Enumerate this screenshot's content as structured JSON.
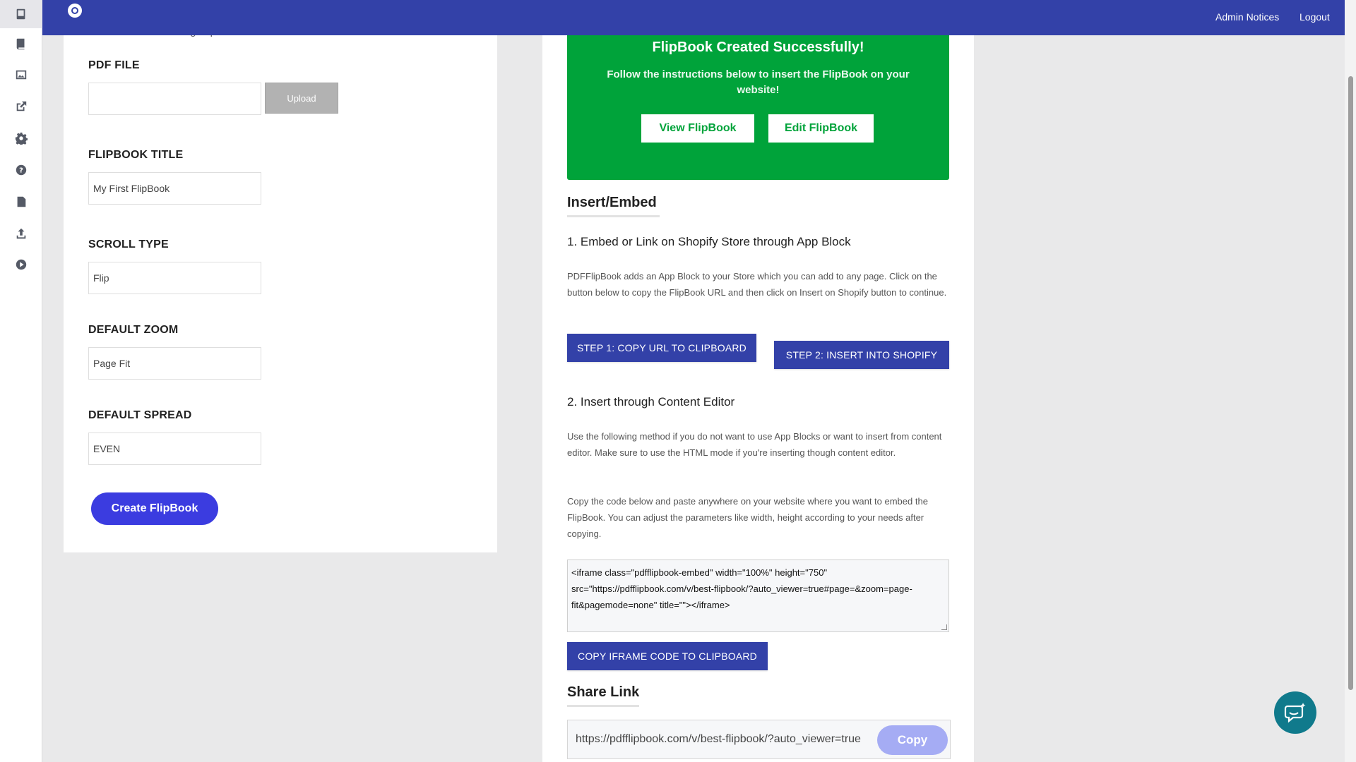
{
  "sidebar": {
    "icons": [
      "flipbooks-icon",
      "book-icon",
      "image-icon",
      "external-link-icon",
      "gear-icon",
      "help-icon",
      "document-icon",
      "upload-icon",
      "play-icon"
    ]
  },
  "topbar": {
    "admin_notices": "Admin Notices",
    "logout": "Logout"
  },
  "form": {
    "cut_text": "and create an amazing FlipBook with that.",
    "pdf_file_label": "PDF FILE",
    "pdf_file_value": "",
    "upload_label": "Upload",
    "title_label": "FLIPBOOK TITLE",
    "title_value": "My First FlipBook",
    "scroll_label": "SCROLL TYPE",
    "scroll_value": "Flip",
    "zoom_label": "DEFAULT ZOOM",
    "zoom_value": "Page Fit",
    "spread_label": "DEFAULT SPREAD",
    "spread_value": "EVEN",
    "create_label": "Create FlipBook"
  },
  "success": {
    "title": "FlipBook Created Successfully!",
    "subtitle": "Follow the instructions below to insert the FlipBook on your website!",
    "view_label": "View FlipBook",
    "edit_label": "Edit FlipBook"
  },
  "embed": {
    "heading": "Insert/Embed",
    "section1_title": "1. Embed or Link on Shopify Store through App Block",
    "section1_text": "PDFFlipBook adds an App Block to your Store which you can add to any page. Click on the button below to copy the FlipBook URL and then click on Insert on Shopify button to continue.",
    "step1_label": "STEP 1: COPY URL TO CLIPBOARD",
    "step2_label": "STEP 2: INSERT INTO SHOPIFY",
    "section2_title": "2. Insert through Content Editor",
    "section2_text1": "Use the following method if you do not want to use App Blocks or want to insert from content editor. Make sure to use the HTML mode if you're inserting though content editor.",
    "section2_text2": "Copy the code below and paste anywhere on your website where you want to embed the FlipBook. You can adjust the parameters like width, height according to your needs after copying.",
    "iframe_code": "<iframe class=\"pdfflipbook-embed\" width=\"100%\" height=\"750\" src=\"https://pdfflipbook.com/v/best-flipbook/?auto_viewer=true#page=&zoom=page-fit&pagemode=none\" title=\"\"></iframe>",
    "copy_iframe_label": "COPY IFRAME CODE TO CLIPBOARD"
  },
  "share": {
    "heading": "Share Link",
    "url": "https://pdfflipbook.com/v/best-flipbook/?auto_viewer=true",
    "copy_label": "Copy"
  },
  "colors": {
    "topbar": "#3341a8",
    "success": "#00a33a",
    "primary_button": "#3b3ce0",
    "step_button": "#3341a8",
    "chat": "#107a8c"
  }
}
